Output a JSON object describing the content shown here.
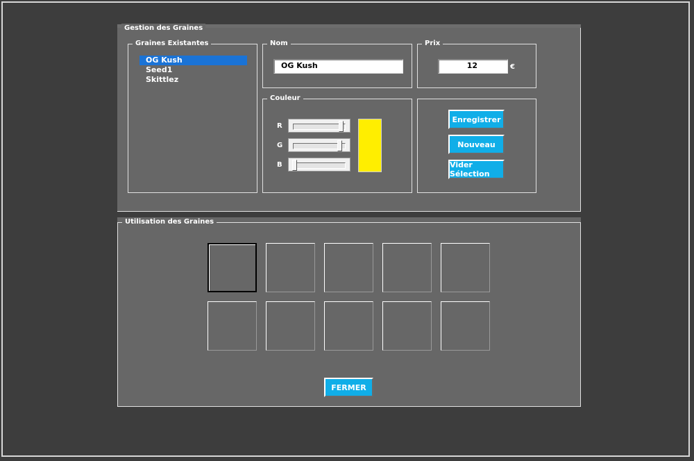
{
  "gestion": {
    "title": "Gestion des Graines",
    "existing": {
      "title": "Graines Existantes",
      "items": [
        "OG Kush",
        "Seed1",
        "Skittlez"
      ],
      "selected_index": 0
    },
    "nom": {
      "title": "Nom",
      "value": "OG Kush"
    },
    "prix": {
      "title": "Prix",
      "value": "12",
      "currency": "€"
    },
    "couleur": {
      "title": "Couleur",
      "r_label": "R",
      "g_label": "G",
      "b_label": "B",
      "r_level": 0.95,
      "g_level": 0.93,
      "b_level": 0.0,
      "swatch_color": "#ffee00"
    },
    "actions": {
      "save": "Enregistrer",
      "new": "Nouveau",
      "clear": "Vider Sélection"
    }
  },
  "utilisation": {
    "title": "Utilisation des Graines",
    "close": "FERMER"
  },
  "colors": {
    "background": "#3d3d3d",
    "panel": "#676767",
    "accent": "#10aee8",
    "selection": "#1a73d6"
  }
}
